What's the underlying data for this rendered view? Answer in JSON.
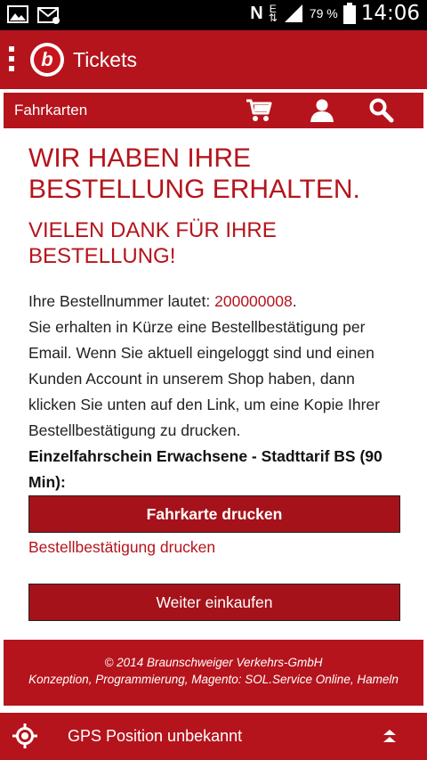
{
  "statusbar": {
    "battery": "79 %",
    "time": "14:06"
  },
  "app": {
    "title": "Tickets",
    "logo_letter": "b"
  },
  "subnav": {
    "label": "Fahrkarten"
  },
  "content": {
    "headline": "WIR HABEN IHRE BESTELLUNG ERHALTEN.",
    "subheadline": "VIELEN DANK FÜR IHRE BESTELLUNG!",
    "order_prefix": "Ihre Bestellnummer lautet: ",
    "order_number": "200000008",
    "order_suffix": ".",
    "info_text": "Sie erhalten in Kürze eine Bestellbestätigung per Email. Wenn Sie aktuell eingeloggt sind und einen Kunden Account in unserem Shop haben, dann klicken Sie unten auf den Link, um eine Kopie Ihrer Bestellbestätigung zu drucken.",
    "product": "Einzelfahrschein Erwachsene - Stadttarif BS (90 Min):",
    "print_ticket_button": "Fahrkarte drucken",
    "print_confirmation_link": "Bestellbestätigung drucken",
    "continue_button": "Weiter einkaufen"
  },
  "footer": {
    "copyright": "© 2014 Braunschweiger Verkehrs-GmbH",
    "credits": "Konzeption, Programmierung, Magento: SOL.Service Online, Hameln"
  },
  "gps": {
    "status": "GPS Position unbekannt"
  },
  "colors": {
    "brand_red": "#b5141c",
    "button_red": "#a5121a"
  }
}
